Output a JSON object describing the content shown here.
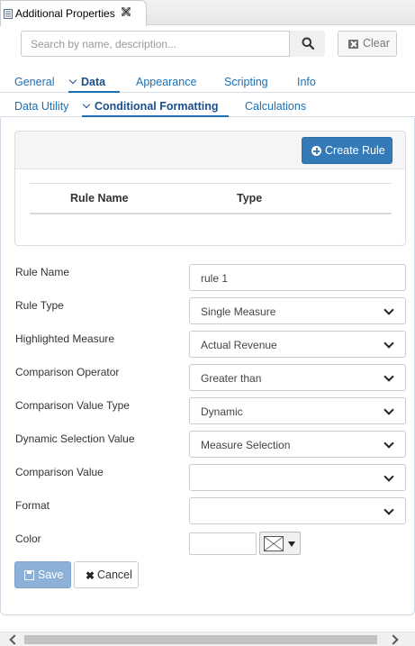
{
  "view_tab": {
    "title": "Additional Properties"
  },
  "search": {
    "placeholder": "Search by name, description...",
    "clear_label": "Clear"
  },
  "tabs_primary": {
    "general": "General",
    "data": "Data",
    "appearance": "Appearance",
    "scripting": "Scripting",
    "info": "Info"
  },
  "tabs_secondary": {
    "data_utility": "Data Utility",
    "conditional_formatting": "Conditional Formatting",
    "calculations": "Calculations"
  },
  "rules": {
    "create_label": "Create Rule",
    "col_rule_name": "Rule Name",
    "col_type": "Type"
  },
  "form": {
    "rule_name": {
      "label": "Rule Name",
      "value": "rule 1"
    },
    "rule_type": {
      "label": "Rule Type",
      "value": "Single Measure"
    },
    "highlighted_measure": {
      "label": "Highlighted Measure",
      "value": "Actual Revenue"
    },
    "comparison_operator": {
      "label": "Comparison Operator",
      "value": "Greater than"
    },
    "comparison_value_type": {
      "label": "Comparison Value Type",
      "value": "Dynamic"
    },
    "dynamic_selection_value": {
      "label": "Dynamic Selection Value",
      "value": "Measure Selection"
    },
    "comparison_value": {
      "label": "Comparison Value",
      "value": ""
    },
    "format": {
      "label": "Format",
      "value": ""
    },
    "color": {
      "label": "Color",
      "value": ""
    }
  },
  "actions": {
    "save_label": "Save",
    "cancel_label": "Cancel"
  },
  "colors": {
    "accent": "#337ab7",
    "tab_text": "#1f6fb0",
    "save_disabled": "#8db0d6"
  }
}
